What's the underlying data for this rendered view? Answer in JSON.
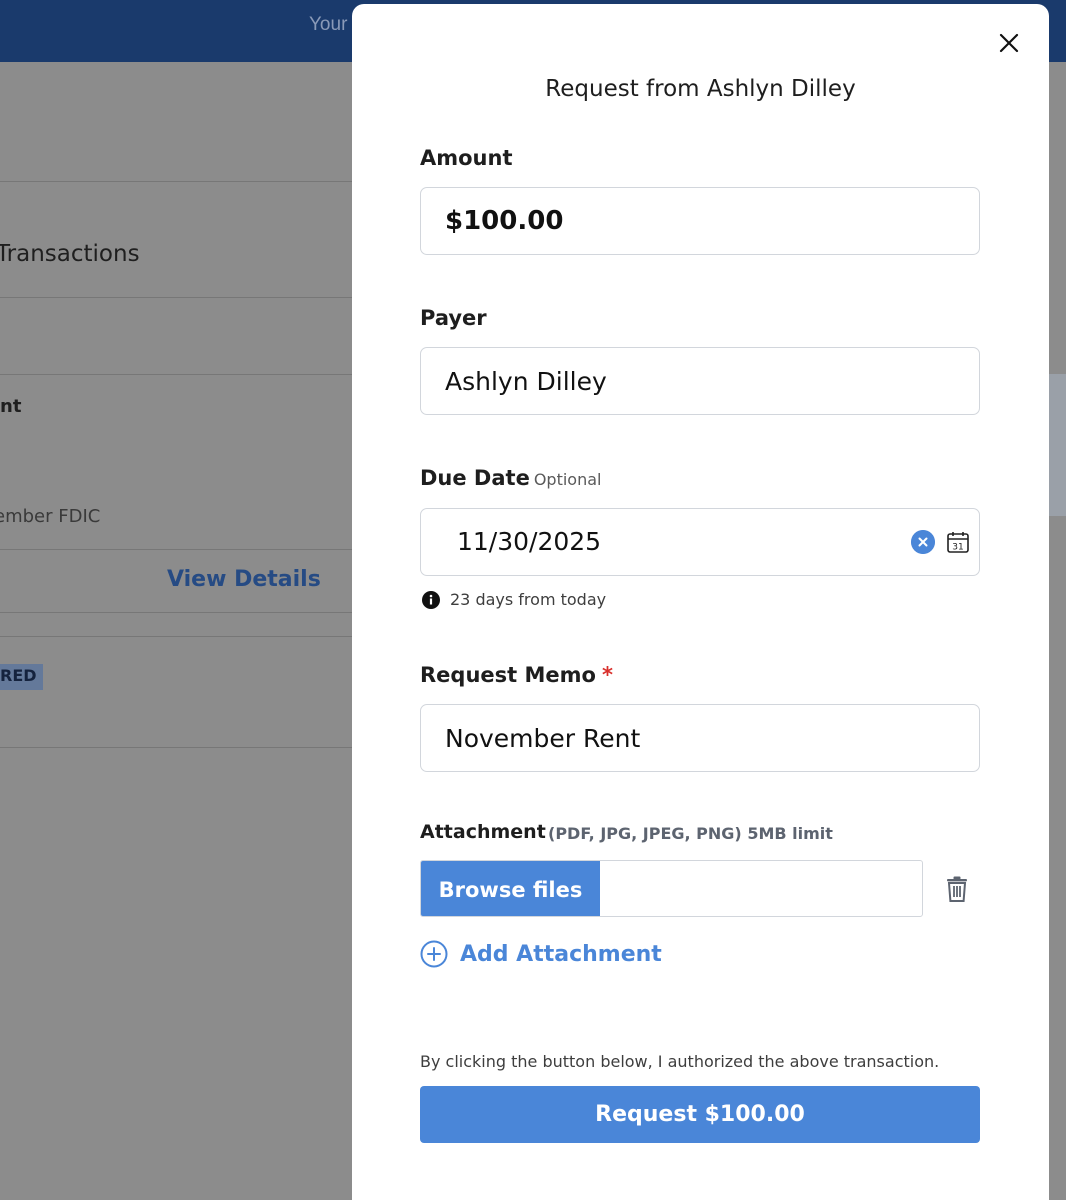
{
  "background": {
    "topbar_text": "Your",
    "transactions_heading": "Transactions",
    "account_label_fragment": "nt",
    "fdic_text": "ember FDIC",
    "view_details_link": "View Details",
    "status_badge": "RED"
  },
  "modal": {
    "title": "Request from Ashlyn Dilley",
    "amount": {
      "label": "Amount",
      "value": "$100.00"
    },
    "payer": {
      "label": "Payer",
      "value": "Ashlyn Dilley"
    },
    "due_date": {
      "label": "Due Date",
      "optional_label": "Optional",
      "value": "11/30/2025",
      "hint": "23 days from today"
    },
    "memo": {
      "label": "Request Memo",
      "required_mark": "*",
      "value": "November Rent"
    },
    "attachment": {
      "label": "Attachment",
      "limit_text": "(PDF, JPG, JPEG, PNG) 5MB limit",
      "browse_label": "Browse files",
      "add_label": "Add Attachment"
    },
    "authorization_text": "By clicking the button below, I authorized the above transaction.",
    "submit_label": "Request $100.00"
  },
  "colors": {
    "accent": "#4a86d8",
    "topbar": "#1a3a6c",
    "required": "#d9302c"
  },
  "icons": [
    "close-icon",
    "clear-date-icon",
    "calendar-icon",
    "info-icon",
    "trash-icon",
    "plus-circle-icon"
  ]
}
